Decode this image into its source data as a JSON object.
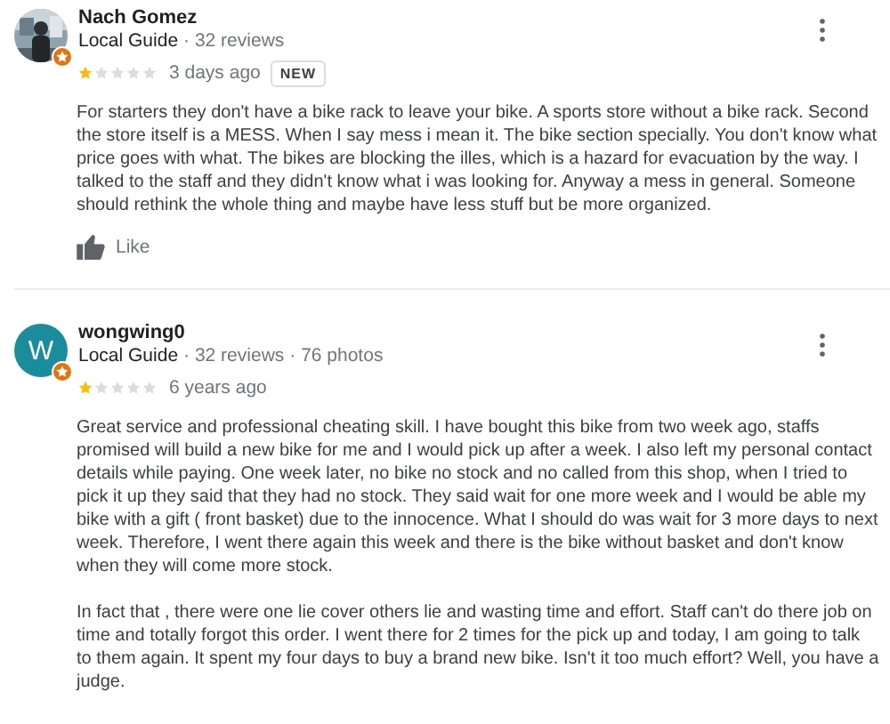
{
  "reviews": [
    {
      "name": "Nach Gomez",
      "avatar": {
        "kind": "picture"
      },
      "guide": "Local Guide",
      "meta": [
        "· 32 reviews"
      ],
      "stars": 1,
      "time": "3 days ago",
      "badge": "NEW",
      "paragraphs": [
        "For starters they don't have a bike rack to leave your bike. A sports store without a bike rack. Second the store itself is a MESS. When I say mess i mean it. The bike section specially. You don't know what price goes with what. The bikes are blocking the illes, which is a hazard for evacuation by the way. I talked to the staff and they didn't know what i was looking for. Anyway a mess in general. Someone should rethink the whole thing and maybe have less stuff but be more organized."
      ],
      "like": "Like"
    },
    {
      "name": "wongwing0",
      "avatar": {
        "kind": "letter",
        "letter": "W",
        "color": "#1a8d9c"
      },
      "guide": "Local Guide",
      "meta": [
        "· 32 reviews",
        "· 76 photos"
      ],
      "stars": 1,
      "time": "6 years ago",
      "paragraphs": [
        "Great service and professional cheating skill. I have bought this bike from two week ago, staffs promised will build a new bike for me and I would pick up after a week. I also left my personal contact details while paying. One week later, no bike no stock and no called from this shop, when I tried to pick it up they said that they had no stock. They said wait for one more week and I would be able my bike with a gift ( front basket) due to the innocence. What I should do was wait for 3 more days to next week. Therefore, I went there again this week and there is the bike without basket and don't know when they will come more stock.",
        "In fact that , there were one lie cover others lie and wasting time and effort. Staff can't do there job on time and totally forgot this order. I went there for 2 times for the pick up and today, I am going to talk to them again. It spent my four days to buy a brand new bike. Isn't it too much effort? Well, you have a judge."
      ]
    }
  ]
}
